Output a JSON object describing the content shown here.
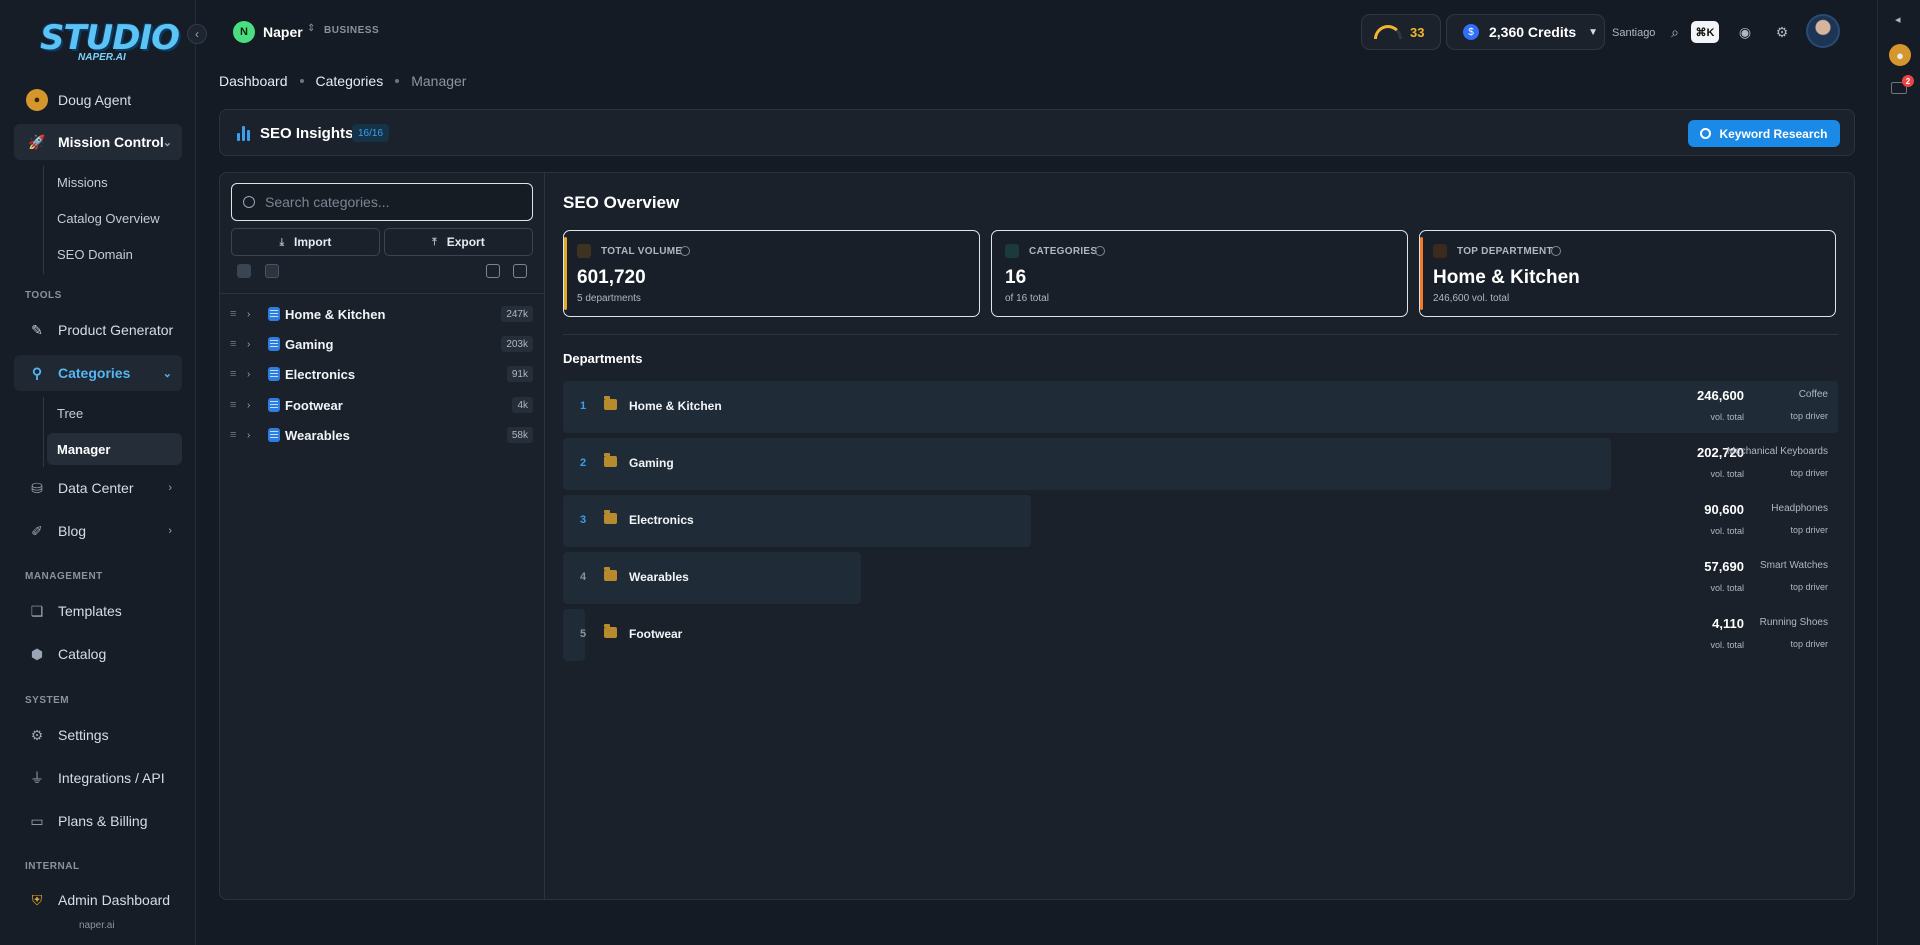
{
  "brand": {
    "logo_text": "STUDIO",
    "logo_sub": "NAPER.AI",
    "footer": "naper.ai"
  },
  "workspace": {
    "initial": "N",
    "name": "Naper",
    "tag": "BUSINESS"
  },
  "sidebar": {
    "agent": "Doug Agent",
    "mission_control": "Mission Control",
    "mission_sub": [
      "Missions",
      "Catalog Overview",
      "SEO Domain"
    ],
    "tools_label": "TOOLS",
    "product_generator": "Product Generator",
    "categories": "Categories",
    "categories_sub": [
      "Tree",
      "Manager"
    ],
    "data_center": "Data Center",
    "blog": "Blog",
    "management_label": "MANAGEMENT",
    "templates": "Templates",
    "catalog": "Catalog",
    "system_label": "SYSTEM",
    "settings": "Settings",
    "integrations": "Integrations / API",
    "plans": "Plans & Billing",
    "internal_label": "INTERNAL",
    "admin": "Admin Dashboard"
  },
  "breadcrumb": [
    "Dashboard",
    "Categories",
    "Manager"
  ],
  "header": {
    "gauge_value": "33",
    "credits": "2,360 Credits",
    "user": "Santiago",
    "shortcut": "⌘K",
    "notification_count": "2"
  },
  "insights": {
    "title": "SEO Insights",
    "count": "16/16",
    "keyword_button": "Keyword Research"
  },
  "left_panel": {
    "search_placeholder": "Search categories...",
    "import_label": "Import",
    "export_label": "Export",
    "tree": [
      {
        "label": "Home & Kitchen",
        "count": "247k"
      },
      {
        "label": "Gaming",
        "count": "203k"
      },
      {
        "label": "Electronics",
        "count": "91k"
      },
      {
        "label": "Footwear",
        "count": "4k"
      },
      {
        "label": "Wearables",
        "count": "58k"
      }
    ]
  },
  "overview": {
    "title": "SEO Overview",
    "cards": [
      {
        "label": "TOTAL VOLUME",
        "value": "601,720",
        "sub": "5 departments",
        "accent": "#e0a82e"
      },
      {
        "label": "CATEGORIES",
        "value": "16",
        "sub": "of 16 total",
        "accent": "#20b2aa"
      },
      {
        "label": "TOP DEPARTMENT",
        "value": "Home & Kitchen",
        "sub": "246,600 vol. total",
        "accent": "#f07a2a"
      }
    ],
    "departments_title": "Departments",
    "departments": [
      {
        "rank": "1",
        "name": "Home & Kitchen",
        "volume": "246,600",
        "volume_label": "vol. total",
        "driver": "Coffee",
        "driver_label": "top driver",
        "share": 1.0
      },
      {
        "rank": "2",
        "name": "Gaming",
        "volume": "202,720",
        "volume_label": "vol. total",
        "driver": "Mechanical Keyboards",
        "driver_label": "top driver",
        "share": 0.822
      },
      {
        "rank": "3",
        "name": "Electronics",
        "volume": "90,600",
        "volume_label": "vol. total",
        "driver": "Headphones",
        "driver_label": "top driver",
        "share": 0.367
      },
      {
        "rank": "4",
        "name": "Wearables",
        "volume": "57,690",
        "volume_label": "vol. total",
        "driver": "Smart Watches",
        "driver_label": "top driver",
        "share": 0.234
      },
      {
        "rank": "5",
        "name": "Footwear",
        "volume": "4,110",
        "volume_label": "vol. total",
        "driver": "Running Shoes",
        "driver_label": "top driver",
        "share": 0.017
      }
    ]
  },
  "colors": {
    "accent_blue": "#1a8ae6",
    "rank_blue": "#3b9eef",
    "rank_grey": "#8892a0",
    "gold": "#f5b52c"
  }
}
